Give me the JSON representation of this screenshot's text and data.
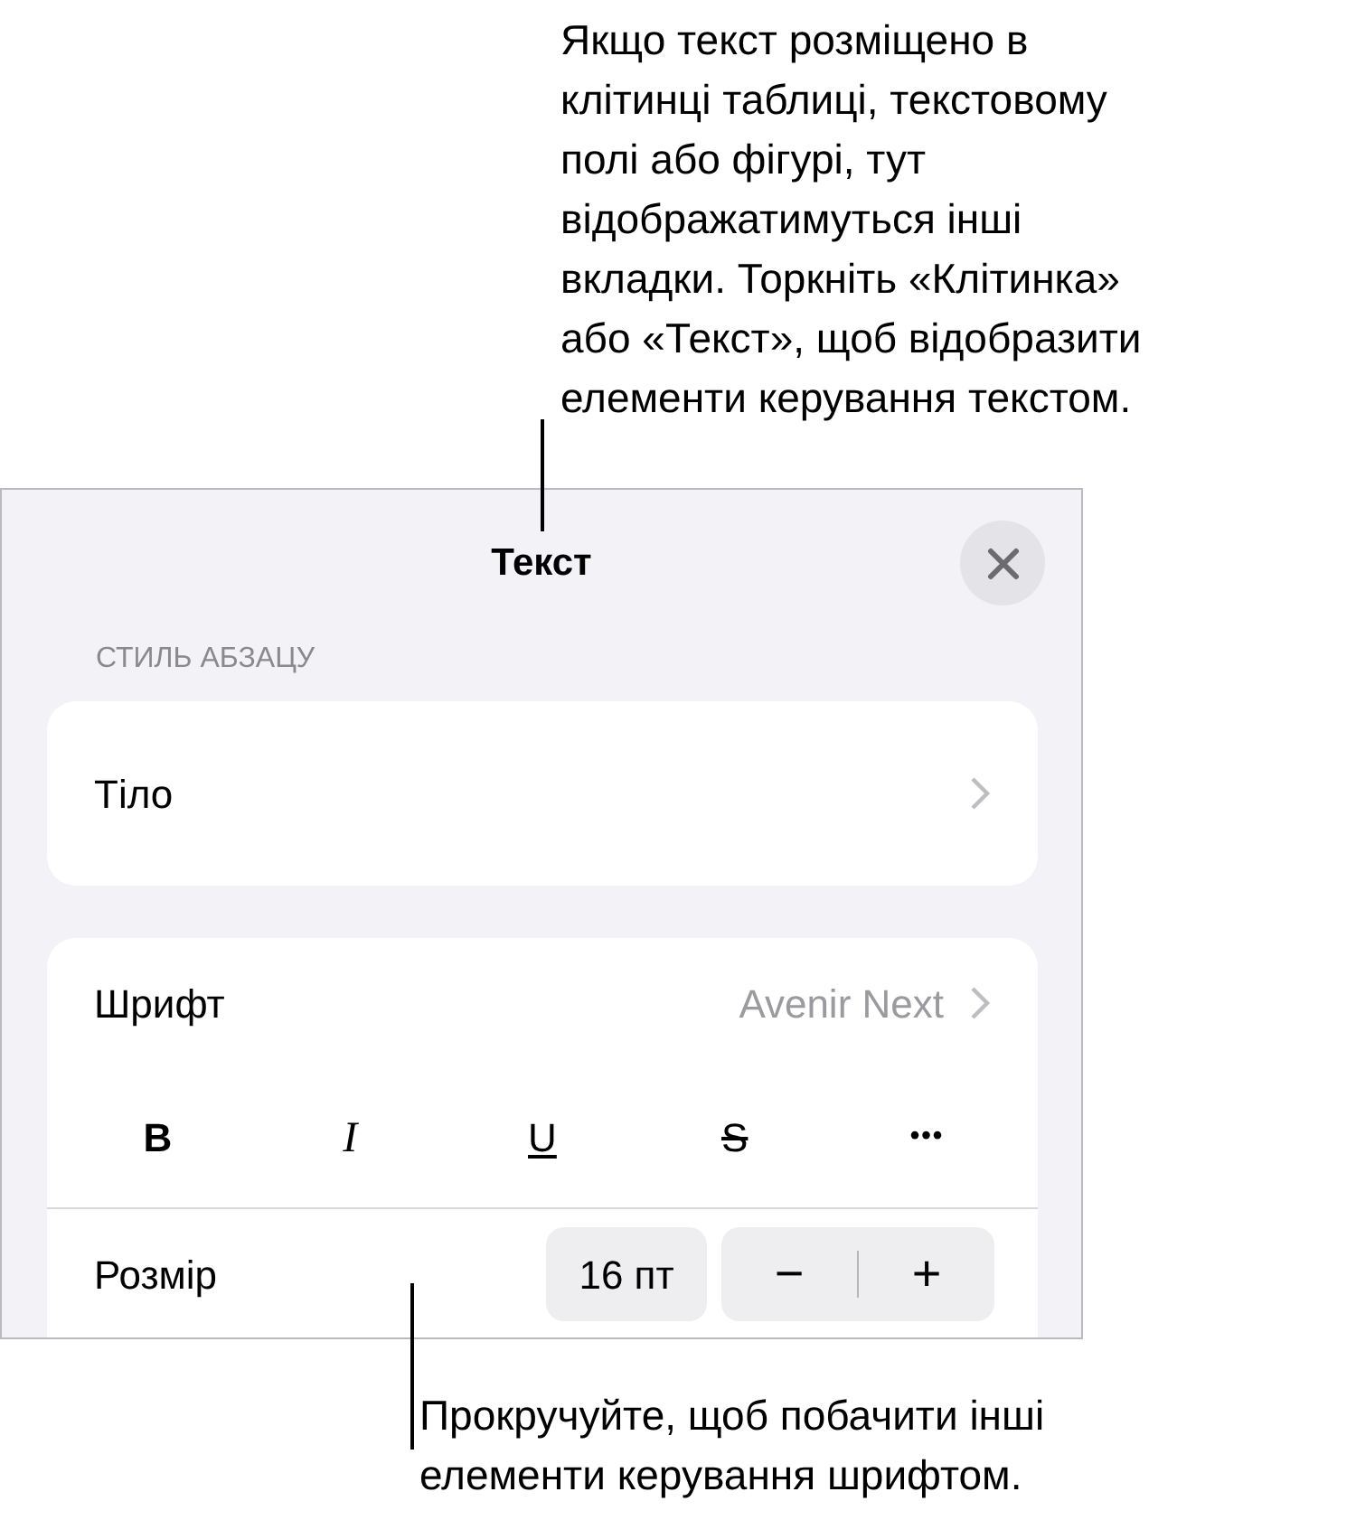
{
  "callouts": [
    {
      "text": "Якщо текст розміщено в\nклітинці таблиці, текстовому\nполі або фігурі, тут\nвідображатимуться інші\nвкладки. Торкніть «Клітинка»\nабо «Текст», щоб відобразити\nелементи керування текстом."
    },
    {
      "text": "Прокручуйте, щоб побачити інші\nелементи керування шрифтом."
    }
  ],
  "panel": {
    "title": "Текст",
    "section_header": "СТИЛЬ АБЗАЦУ",
    "paragraph_style": "Тіло",
    "font": {
      "label": "Шрифт",
      "value": "Avenir Next"
    },
    "format_buttons": [
      {
        "kind": "bold",
        "label": "B"
      },
      {
        "kind": "italic",
        "label": "I"
      },
      {
        "kind": "underline",
        "label": "U"
      },
      {
        "kind": "strikethrough",
        "label": "S"
      },
      {
        "kind": "more",
        "label": "•••"
      }
    ],
    "size": {
      "label": "Розмір",
      "value": "16 пт",
      "decrement": "−",
      "increment": "+"
    }
  }
}
